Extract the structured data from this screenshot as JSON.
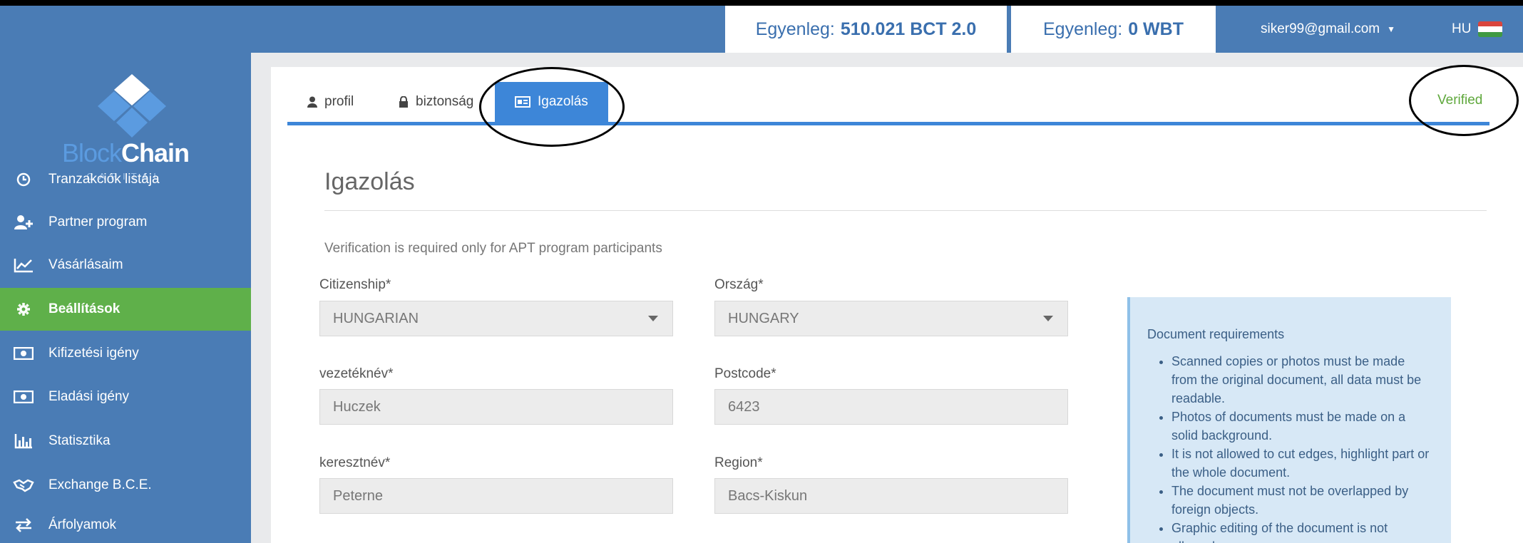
{
  "topbar": {
    "balance1_prefix": "Egyenleg:",
    "balance1_value": "510.021 BCT 2.0",
    "balance2_prefix": "Egyenleg:",
    "balance2_value": "0 WBT",
    "user_email": "siker99@gmail.com",
    "language": "HU"
  },
  "logo": {
    "part1": "Block",
    "part2": "Chain",
    "subtitle": "CAPITAL"
  },
  "sidebar": {
    "items": [
      {
        "label": "Tranzakciók listája",
        "icon": "clock-icon"
      },
      {
        "label": "Partner program",
        "icon": "add-user-icon"
      },
      {
        "label": "Vásárlásaim",
        "icon": "chart-line-icon"
      },
      {
        "label": "Beállítások",
        "icon": "gear-icon",
        "active": true
      },
      {
        "label": "Kifizetési igény",
        "icon": "money-icon"
      },
      {
        "label": "Eladási igény",
        "icon": "money-icon"
      },
      {
        "label": "Statisztika",
        "icon": "bar-chart-icon"
      },
      {
        "label": "Exchange B.C.E.",
        "icon": "handshake-icon"
      },
      {
        "label": "Árfolyamok",
        "icon": "exchange-arrows-icon"
      }
    ]
  },
  "tabs": [
    {
      "label": "profil",
      "icon": "user-icon"
    },
    {
      "label": "biztonság",
      "icon": "lock-icon"
    },
    {
      "label": "Igazolás",
      "icon": "id-card-icon",
      "active": true
    }
  ],
  "status": "Verified",
  "page": {
    "title": "Igazolás",
    "note": "Verification is required only for APT program participants"
  },
  "form": {
    "citizenship_label": "Citizenship*",
    "citizenship_value": "HUNGARIAN",
    "country_label": "Ország*",
    "country_value": "HUNGARY",
    "lastname_label": "vezetéknév*",
    "lastname_value": "Huczek",
    "postcode_label": "Postcode*",
    "postcode_value": "6423",
    "firstname_label": "keresztnév*",
    "firstname_value": "Peterne",
    "region_label": "Region*",
    "region_value": "Bacs-Kiskun"
  },
  "requirements": {
    "title": "Document requirements",
    "items": [
      "Scanned copies or photos must be made from the original document, all data must be readable.",
      "Photos of documents must be made on a solid background.",
      "It is not allowed to cut edges, highlight part or the whole document.",
      "The document must not be overlapped by foreign objects.",
      "Graphic editing of the document is not allowed."
    ]
  },
  "colors": {
    "sidebar": "#4a7cb5",
    "active_nav": "#5fb04a",
    "tab_active": "#3d86d8",
    "verified": "#5fa83c",
    "info_box": "#d7e8f6"
  }
}
